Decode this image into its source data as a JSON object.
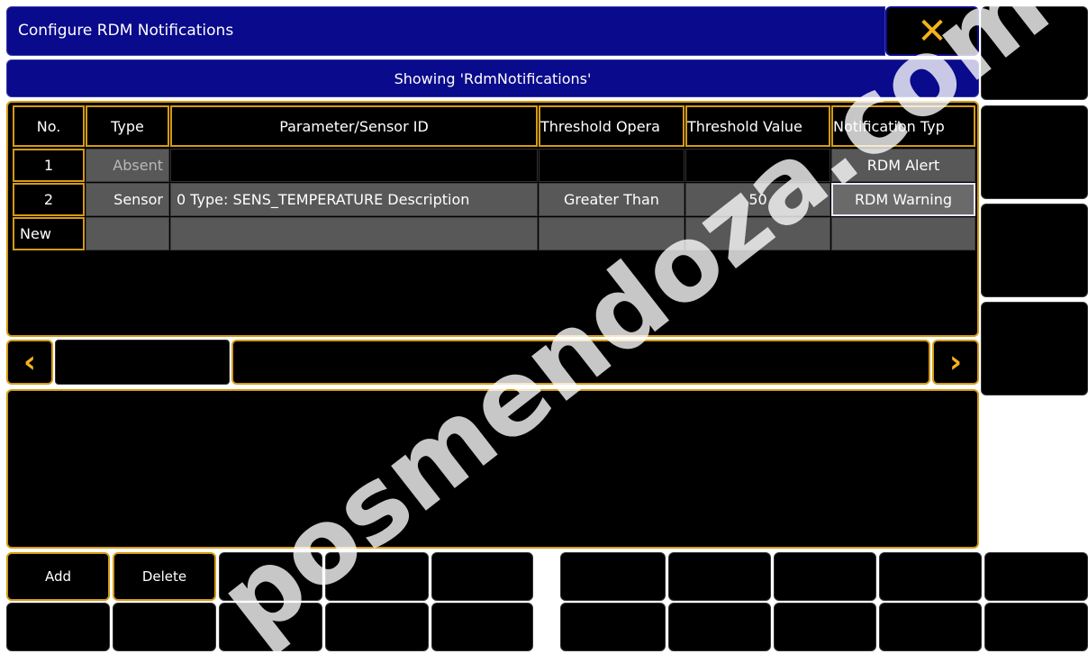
{
  "window": {
    "title": "Configure RDM Notifications",
    "close_icon": "x-close-icon",
    "showing_label": "Showing 'RdmNotifications'"
  },
  "table": {
    "columns": [
      "No.",
      "Type",
      "Parameter/Sensor ID",
      "Threshold Opera",
      "Threshold Value",
      "Notification Typ"
    ],
    "rows": [
      {
        "no": "1",
        "type": "Absent",
        "param": "",
        "op": "",
        "value": "",
        "notif": "RDM Alert"
      },
      {
        "no": "2",
        "type": "Sensor",
        "param": "0 Type: SENS_TEMPERATURE Description",
        "op": "Greater Than",
        "value": "50",
        "notif": "RDM Warning"
      }
    ],
    "new_label": "New"
  },
  "scroll": {
    "left_icon": "chevron-left-icon",
    "right_icon": "chevron-right-icon"
  },
  "buttons": {
    "add": "Add",
    "delete": "Delete"
  },
  "colors": {
    "title_blue": "#0a0a8c",
    "accent_gold": "#d49a14",
    "close_gold": "#f5b21e",
    "row_grey": "#585858"
  },
  "watermark": "posmendoza.com"
}
